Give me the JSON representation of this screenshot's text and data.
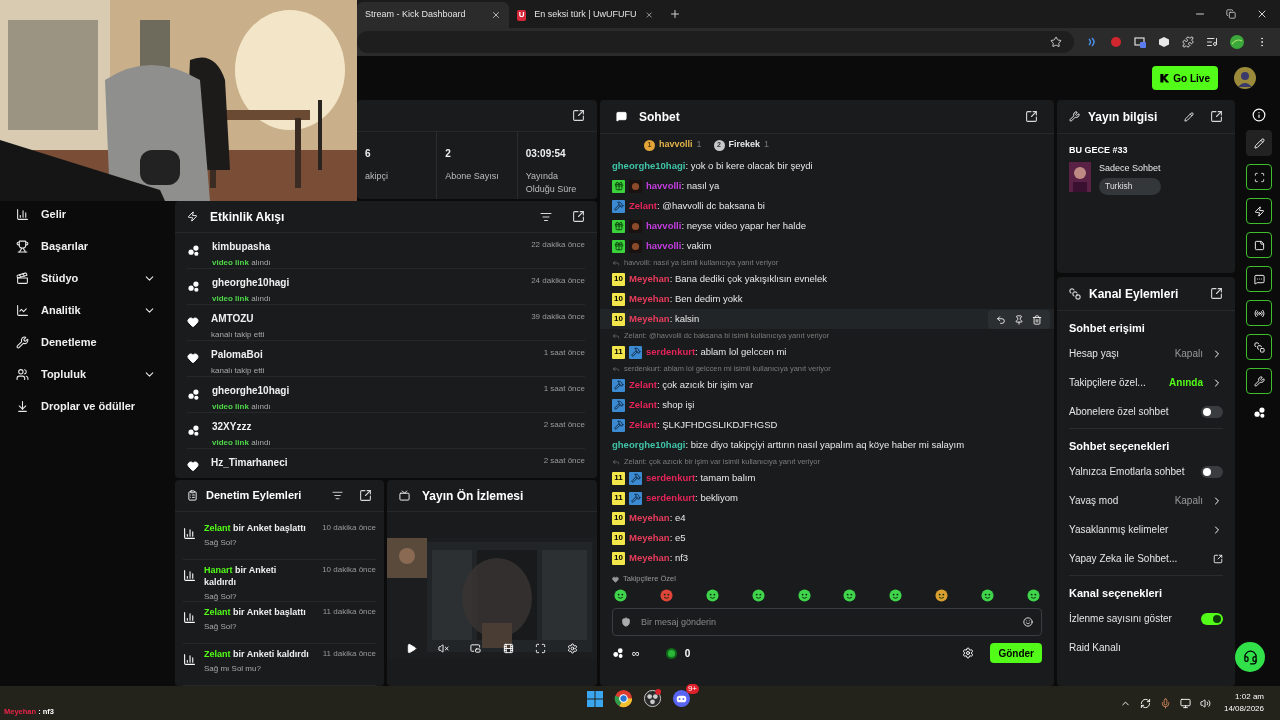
{
  "browser": {
    "tabs": [
      {
        "title": "Stream - Kick Dashboard",
        "selected": true
      },
      {
        "title": "En seksi türk | UwUFUFU",
        "icon_letter": "U",
        "selected": false
      }
    ]
  },
  "header": {
    "go_live": "Go Live"
  },
  "sidebar": {
    "items": [
      {
        "label": "Gelir",
        "kind": "link"
      },
      {
        "label": "Başarılar",
        "kind": "link"
      },
      {
        "label": "Stüdyo",
        "kind": "group"
      },
      {
        "label": "Analitik",
        "kind": "group"
      },
      {
        "label": "Denetleme",
        "kind": "link"
      },
      {
        "label": "Topluluk",
        "kind": "group"
      },
      {
        "label": "Droplar ve ödüller",
        "kind": "link"
      }
    ]
  },
  "stats": [
    {
      "value": "6",
      "label": "akipçi"
    },
    {
      "value": "2",
      "label": "Abone Sayısı"
    },
    {
      "value": "03:09:54",
      "label": "Yayında Olduğu Süre"
    }
  ],
  "activity_feed": {
    "title": "Etkinlik Akışı",
    "items": [
      {
        "kind": "media",
        "user": "kimbupasha",
        "highlight": "video link",
        "text": "alındı",
        "time": "22 dakika önce"
      },
      {
        "kind": "media",
        "user": "gheorghe10hagi",
        "highlight": "video link",
        "text": "alındı",
        "time": "24 dakika önce"
      },
      {
        "kind": "follow",
        "user": "AMTOZU",
        "text": "kanalı takip etti",
        "time": "39 dakika önce"
      },
      {
        "kind": "follow",
        "user": "PalomaBoi",
        "text": "kanalı takip etti",
        "time": "1 saat önce"
      },
      {
        "kind": "media",
        "user": "gheorghe10hagi",
        "highlight": "video link",
        "text": "alındı",
        "time": "1 saat önce"
      },
      {
        "kind": "media",
        "user": "32XYzzz",
        "highlight": "video link",
        "text": "alındı",
        "time": "2 saat önce"
      },
      {
        "kind": "follow",
        "user": "Hz_Timarhaneci",
        "time": "2 saat önce"
      }
    ]
  },
  "moderation": {
    "title": "Denetim Eylemleri",
    "items": [
      {
        "user": "Zelant",
        "action": "bir Anket başlattı",
        "time": "10 dakika önce",
        "detail": "Sağ Sol?"
      },
      {
        "user": "Hanart",
        "action": "bir Anketi kaldırdı",
        "time": "10 dakika önce",
        "detail": "Sağ Sol?"
      },
      {
        "user": "Zelant",
        "action": "bir Anket başlattı",
        "time": "11 dakika önce",
        "detail": "Sağ Sol?"
      },
      {
        "user": "Zelant",
        "action": "bir Anketi kaldırdı",
        "time": "11 dakika önce",
        "detail": "Sağ mı Sol mu?"
      }
    ]
  },
  "preview": {
    "title": "Yayın Ön İzlemesi"
  },
  "chat": {
    "title": "Sohbet",
    "leaders": [
      {
        "rank": "1",
        "user": "havvolli",
        "count": "1"
      },
      {
        "rank": "2",
        "user": "Firekek",
        "count": "1"
      }
    ],
    "messages": [
      {
        "kind": "message",
        "user": "gheorghe10hagi",
        "color": "#3fc4a8",
        "text": ": yok o bi kere olacak bir şeydi",
        "hovered": false
      },
      {
        "kind": "message",
        "user": "havvolli",
        "color": "#c43ee0",
        "badges": [
          {
            "kind": "gift"
          },
          {
            "kind": "founder"
          }
        ],
        "text": ": nasıl ya",
        "hovered": false
      },
      {
        "kind": "message",
        "user": "Zelant",
        "color": "#e5245a",
        "badges": [
          {
            "kind": "mod"
          }
        ],
        "text": ": @havvolli dc baksana bi",
        "hovered": false
      },
      {
        "kind": "message",
        "user": "havvolli",
        "color": "#c43ee0",
        "badges": [
          {
            "kind": "gift"
          },
          {
            "kind": "founder"
          }
        ],
        "text": ": neyse video yapar her halde",
        "hovered": false
      },
      {
        "kind": "message",
        "user": "havvolli",
        "color": "#c43ee0",
        "badges": [
          {
            "kind": "gift"
          },
          {
            "kind": "founder"
          }
        ],
        "text": ": vakim",
        "hovered": false
      },
      {
        "kind": "reply",
        "text": "havvolli: nasıl ya isimli kullanıcıya yanıt veriyor"
      },
      {
        "kind": "message",
        "user": "Meyehan",
        "color": "#e83c5c",
        "badges": [
          {
            "kind": "sub",
            "label": "10"
          }
        ],
        "text": ": Bana dediki çok yakışıklısın evnelek",
        "hovered": false
      },
      {
        "kind": "message",
        "user": "Meyehan",
        "color": "#e83c5c",
        "badges": [
          {
            "kind": "sub",
            "label": "10"
          }
        ],
        "text": ": Ben dedim yokk",
        "hovered": false
      },
      {
        "kind": "message",
        "user": "Meyehan",
        "color": "#e83c5c",
        "badges": [
          {
            "kind": "sub",
            "label": "10"
          }
        ],
        "text": ": kalsin",
        "hovered": true
      },
      {
        "kind": "reply",
        "text": "Zelant: @havvolli dc baksana bi isimli kullanıcıya yanıt veriyor"
      },
      {
        "kind": "message",
        "user": "serdenkurt",
        "color": "#e5245a",
        "badges": [
          {
            "kind": "sub",
            "label": "11"
          },
          {
            "kind": "mod"
          }
        ],
        "text": ": ablam lol gelccen mi",
        "hovered": false
      },
      {
        "kind": "reply",
        "text": "serdenkurt: ablam lol gelccen mi isimli kullanıcıya yanıt veriyor"
      },
      {
        "kind": "message",
        "user": "Zelant",
        "color": "#e5245a",
        "badges": [
          {
            "kind": "mod"
          }
        ],
        "text": ": çok azıcık bir işim var",
        "hovered": false
      },
      {
        "kind": "message",
        "user": "Zelant",
        "color": "#e5245a",
        "badges": [
          {
            "kind": "mod"
          }
        ],
        "text": ": shop işi",
        "hovered": false
      },
      {
        "kind": "message",
        "user": "Zelant",
        "color": "#e5245a",
        "badges": [
          {
            "kind": "mod"
          }
        ],
        "text": ": ŞLKJFHDGSLIKDJFHGSD",
        "hovered": false
      },
      {
        "kind": "message",
        "user": "gheorghe10hagi",
        "color": "#3fc4a8",
        "text": ": bize diyo takipçiyi arttırın nasıl yapalım aq köye haber mi salayım",
        "hovered": false
      },
      {
        "kind": "reply",
        "text": "Zelant: çok azıcık bir işim var isimli kullanıcıya yanıt veriyor"
      },
      {
        "kind": "message",
        "user": "serdenkurt",
        "color": "#e5245a",
        "badges": [
          {
            "kind": "sub",
            "label": "11"
          },
          {
            "kind": "mod"
          }
        ],
        "text": ": tamam balım",
        "hovered": false
      },
      {
        "kind": "message",
        "user": "serdenkurt",
        "color": "#e5245a",
        "badges": [
          {
            "kind": "sub",
            "label": "11"
          },
          {
            "kind": "mod"
          }
        ],
        "text": ": bekliyom",
        "hovered": false
      },
      {
        "kind": "message",
        "user": "Meyehan",
        "color": "#e83c5c",
        "badges": [
          {
            "kind": "sub",
            "label": "10"
          }
        ],
        "text": ": e4",
        "hovered": false
      },
      {
        "kind": "message",
        "user": "Meyehan",
        "color": "#e83c5c",
        "badges": [
          {
            "kind": "sub",
            "label": "10"
          }
        ],
        "text": ": e5",
        "hovered": false
      },
      {
        "kind": "message",
        "user": "Meyehan",
        "color": "#e83c5c",
        "badges": [
          {
            "kind": "sub",
            "label": "10"
          }
        ],
        "text": ": nf3",
        "hovered": false
      }
    ],
    "followers_only": "Takipçilere Özel",
    "placeholder": "Bir mesaj gönderin",
    "points": "∞",
    "coins": "0",
    "send": "Gönder"
  },
  "stream_info": {
    "title": "Yayın bilgisi",
    "stream_title": "BU GECE #33",
    "category": "Sadece Sohbet",
    "tag": "Turkish"
  },
  "channel_actions": {
    "title": "Kanal Eylemleri",
    "sections": [
      {
        "title": "Sohbet erişimi",
        "rows": [
          {
            "kind": "link",
            "label": "Hesap yaşı",
            "value": "Kapalı",
            "active": false
          },
          {
            "kind": "link",
            "label": "Takipçilere özel...",
            "value": "Anında",
            "active": true
          },
          {
            "kind": "toggle",
            "label": "Abonelere özel sohbet",
            "on": false
          }
        ]
      },
      {
        "title": "Sohbet seçenekleri",
        "rows": [
          {
            "kind": "toggle",
            "label": "Yalnızca Emotlarla sohbet",
            "on": false
          },
          {
            "kind": "link",
            "label": "Yavaş mod",
            "value": "Kapalı",
            "active": false
          },
          {
            "kind": "link",
            "label": "Yasaklanmış kelimeler"
          },
          {
            "kind": "external",
            "label": "Yapay Zeka ile Sohbet..."
          }
        ]
      },
      {
        "title": "Kanal seçenekleri",
        "rows": [
          {
            "kind": "toggle",
            "label": "İzlenme sayısını göster",
            "on": true
          },
          {
            "kind": "plain",
            "label": "Raid Kanalı"
          }
        ]
      }
    ]
  },
  "overlay": {
    "user": "Meyehan",
    "text": ": nf3"
  },
  "taskbar": {
    "discord_badge": "9+",
    "time": "1:02 am",
    "date": "14/08/2026"
  }
}
